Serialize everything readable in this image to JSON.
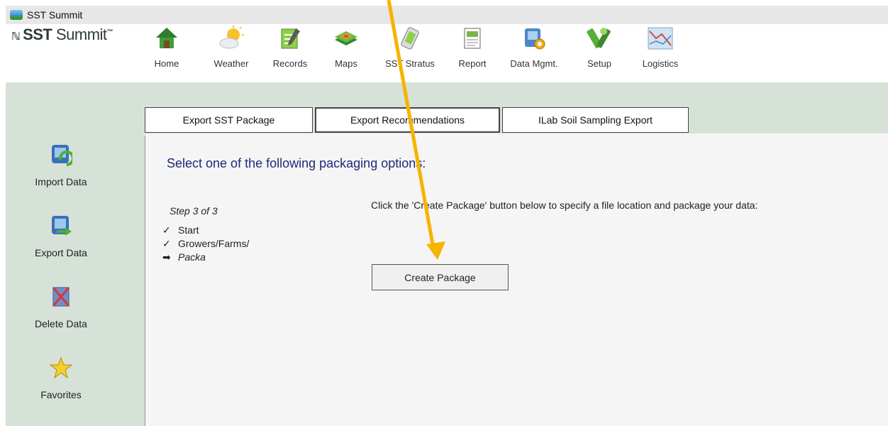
{
  "window": {
    "title": "SST Summit"
  },
  "logo": {
    "mark": "ℕ",
    "brand": "SST",
    "name": "Summit",
    "tm": "™"
  },
  "toolbar": {
    "items": [
      {
        "label": "Home",
        "icon": "home-icon"
      },
      {
        "label": "Weather",
        "icon": "weather-icon"
      },
      {
        "label": "Records",
        "icon": "records-icon"
      },
      {
        "label": "Maps",
        "icon": "maps-icon"
      },
      {
        "label": "SST Stratus",
        "icon": "stratus-icon"
      },
      {
        "label": "Report",
        "icon": "report-icon"
      },
      {
        "label": "Data Mgmt.",
        "icon": "data-mgmt-icon"
      },
      {
        "label": "Setup",
        "icon": "setup-icon"
      },
      {
        "label": "Logistics",
        "icon": "logistics-icon"
      }
    ]
  },
  "sidebar": {
    "items": [
      {
        "label": "Import Data",
        "icon": "import-data-icon"
      },
      {
        "label": "Export Data",
        "icon": "export-data-icon"
      },
      {
        "label": "Delete Data",
        "icon": "delete-data-icon"
      },
      {
        "label": "Favorites",
        "icon": "star-icon"
      }
    ]
  },
  "tabs": [
    {
      "label": "Export SST Package",
      "active": false
    },
    {
      "label": "Export Recommendations",
      "active": true
    },
    {
      "label": "ILab Soil Sampling Export",
      "active": false
    }
  ],
  "content": {
    "heading": "Select one of the following packaging options:",
    "step_label": "Step 3 of 3",
    "steps": [
      {
        "mark": "✓",
        "label": "Start"
      },
      {
        "mark": "✓",
        "label": "Growers/Farms/"
      },
      {
        "mark": "➡",
        "label": "Packa"
      }
    ],
    "instruction": "Click the 'Create Package' button below to specify a file location and package your data:",
    "create_button": "Create Package"
  },
  "colors": {
    "sidebar_bg": "#d6e2d8",
    "heading": "#1d2a7a",
    "annotation_arrow": "#f5b400"
  }
}
